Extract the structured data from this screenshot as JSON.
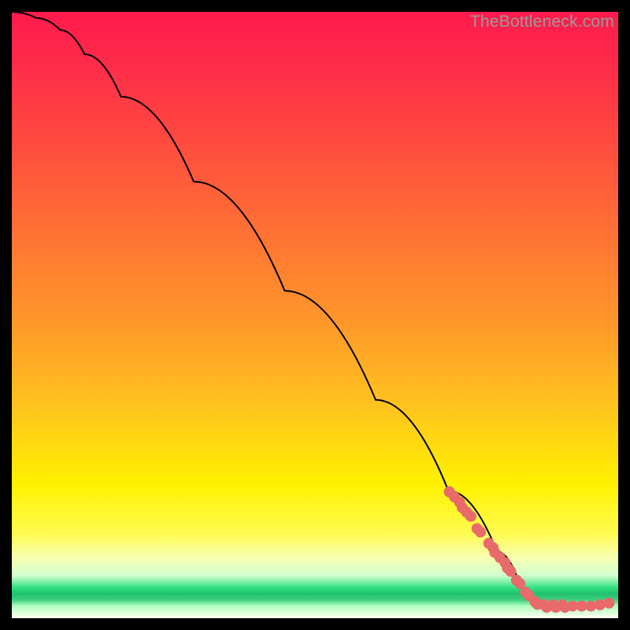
{
  "watermark": "TheBottleneck.com",
  "chart_data": {
    "type": "line",
    "title": "",
    "xlabel": "",
    "ylabel": "",
    "xlim": [
      0,
      100
    ],
    "ylim": [
      0,
      100
    ],
    "curve": [
      {
        "x": 0,
        "y": 100
      },
      {
        "x": 4,
        "y": 99
      },
      {
        "x": 8,
        "y": 97
      },
      {
        "x": 12,
        "y": 93
      },
      {
        "x": 18,
        "y": 86
      },
      {
        "x": 30,
        "y": 72
      },
      {
        "x": 45,
        "y": 54
      },
      {
        "x": 60,
        "y": 36
      },
      {
        "x": 72,
        "y": 21
      },
      {
        "x": 80,
        "y": 11
      },
      {
        "x": 84,
        "y": 5
      },
      {
        "x": 86,
        "y": 2.5
      },
      {
        "x": 88,
        "y": 2
      },
      {
        "x": 92,
        "y": 2
      },
      {
        "x": 96,
        "y": 2
      },
      {
        "x": 99,
        "y": 2.5
      }
    ],
    "marker_clusters": [
      {
        "cx": 73,
        "cy": 20,
        "count": 3,
        "spread": 1.2
      },
      {
        "cx": 75,
        "cy": 17.5,
        "count": 3,
        "spread": 1.0
      },
      {
        "cx": 77,
        "cy": 14.5,
        "count": 2,
        "spread": 0.8
      },
      {
        "cx": 79,
        "cy": 12,
        "count": 2,
        "spread": 1.0
      },
      {
        "cx": 80.5,
        "cy": 10,
        "count": 3,
        "spread": 1.2
      },
      {
        "cx": 82,
        "cy": 8,
        "count": 2,
        "spread": 0.8
      },
      {
        "cx": 83.5,
        "cy": 6,
        "count": 2,
        "spread": 0.8
      },
      {
        "cx": 85,
        "cy": 4,
        "count": 2,
        "spread": 0.8
      },
      {
        "cx": 86.5,
        "cy": 2.5,
        "count": 2,
        "spread": 0.6
      },
      {
        "cx": 88,
        "cy": 2,
        "count": 2,
        "spread": 0.6
      },
      {
        "cx": 89.5,
        "cy": 2,
        "count": 2,
        "spread": 0.6
      },
      {
        "cx": 91,
        "cy": 2,
        "count": 2,
        "spread": 0.6
      },
      {
        "cx": 92.5,
        "cy": 2,
        "count": 1,
        "spread": 0
      },
      {
        "cx": 94,
        "cy": 2,
        "count": 1,
        "spread": 0
      },
      {
        "cx": 95.5,
        "cy": 2,
        "count": 1,
        "spread": 0
      },
      {
        "cx": 97,
        "cy": 2.2,
        "count": 1,
        "spread": 0
      },
      {
        "cx": 98.5,
        "cy": 2.5,
        "count": 1,
        "spread": 0
      }
    ],
    "marker_radius_px": 7,
    "marker_color": "#e86a6a"
  }
}
